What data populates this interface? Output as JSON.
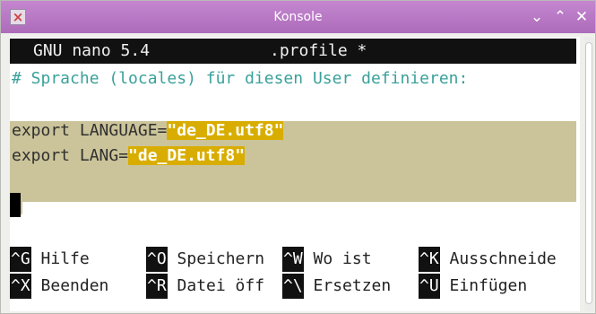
{
  "window": {
    "title": "Konsole",
    "buttons": {
      "minimize": "⌄",
      "maximize": "⌃",
      "close": "✕"
    },
    "icon": "konsole-app-icon"
  },
  "nano": {
    "version": "GNU nano 5.4",
    "filename": ".profile *",
    "lines": {
      "comment": "# Sprache (locales) für diesen User definieren:",
      "line1_prefix": "export LANGUAGE=",
      "line1_value": "\"de_DE.utf8\"",
      "line2_prefix": "export LANG=",
      "line2_value": "\"de_DE.utf8\""
    },
    "shortcuts_row1": [
      {
        "key": "^G",
        "label": "Hilfe"
      },
      {
        "key": "^O",
        "label": "Speichern"
      },
      {
        "key": "^W",
        "label": "Wo ist"
      },
      {
        "key": "^K",
        "label": "Ausschneide"
      }
    ],
    "shortcuts_row2": [
      {
        "key": "^X",
        "label": "Beenden"
      },
      {
        "key": "^R",
        "label": "Datei öff"
      },
      {
        "key": "^\\",
        "label": "Ersetzen"
      },
      {
        "key": "^U",
        "label": "Einfügen"
      }
    ]
  },
  "colors": {
    "titlebar": "#b573c2",
    "comment": "#3aa19a",
    "string_highlight": "#d8ad00",
    "line_highlight": "#cbc49a"
  }
}
